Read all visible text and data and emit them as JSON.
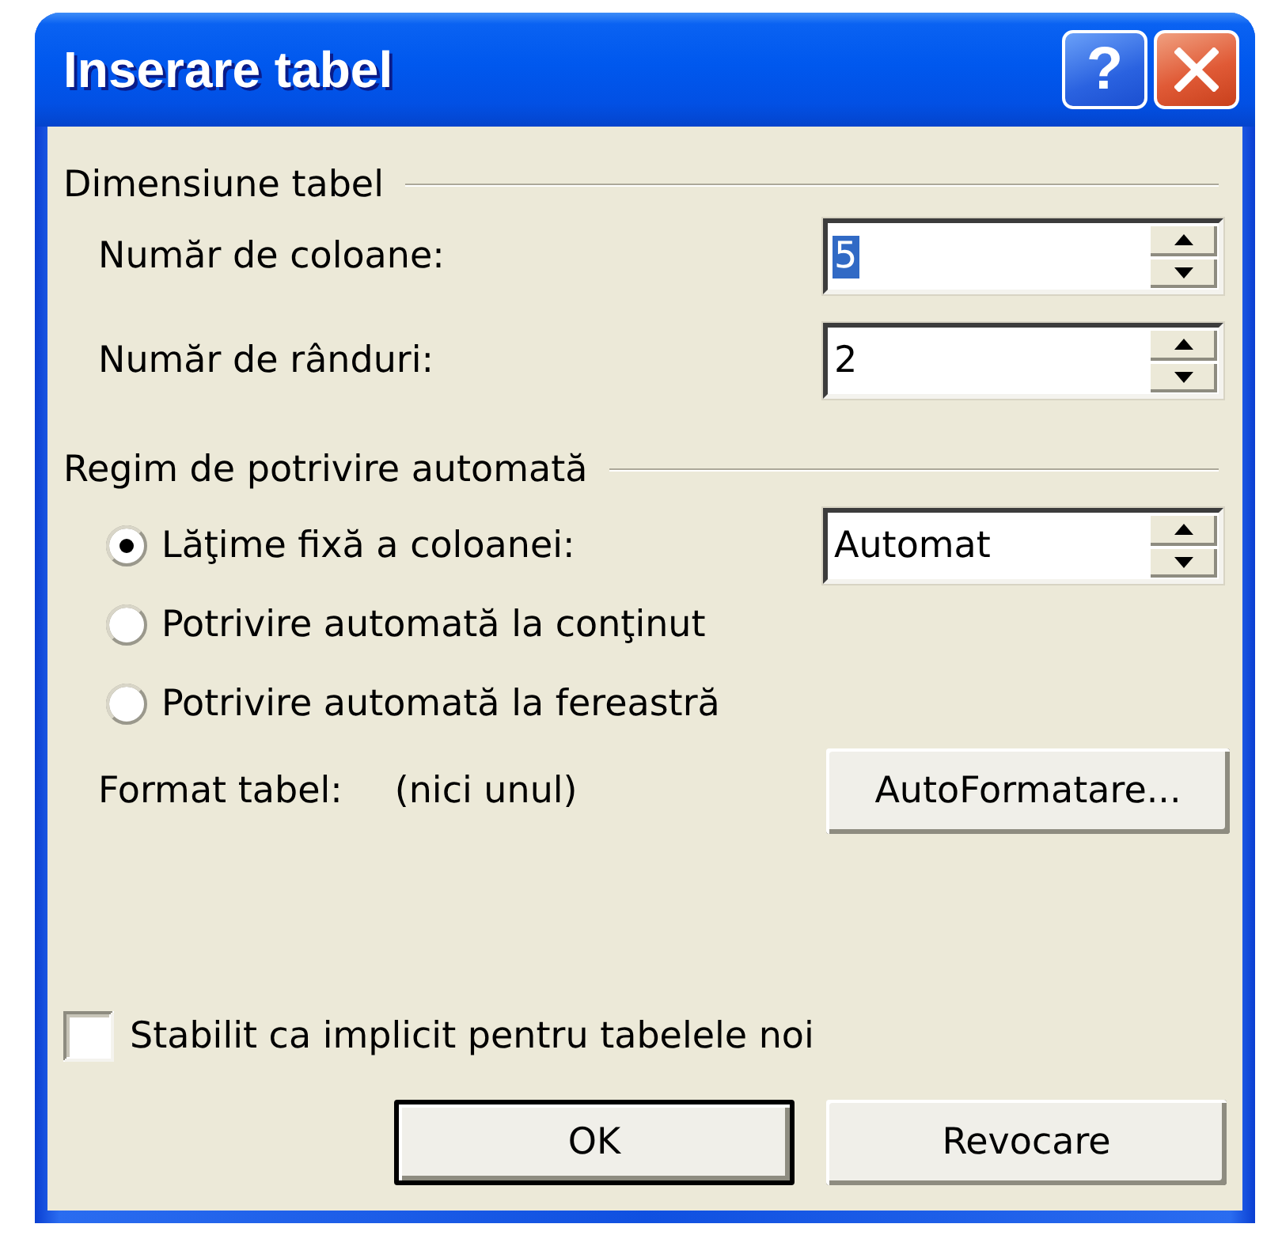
{
  "window": {
    "title": "Inserare tabel",
    "help_label": "?"
  },
  "groups": [
    {
      "title": "Dimensiune tabel",
      "rows": [
        {
          "kind": "spin",
          "label": "Număr de coloane:",
          "value": "5",
          "text_selected": true
        },
        {
          "kind": "spin",
          "label": "Număr de rânduri:",
          "value": "2",
          "text_selected": false
        }
      ]
    },
    {
      "title": "Regim de potrivire automată",
      "rows": [
        {
          "kind": "radio",
          "label": "Lăţime fixă a coloanei:",
          "selected": true,
          "field_value": "Automat"
        },
        {
          "kind": "radio",
          "label": "Potrivire automată la conţinut",
          "selected": false
        },
        {
          "kind": "radio",
          "label": "Potrivire automată la fereastră",
          "selected": false
        },
        {
          "kind": "format",
          "label": "Format tabel:",
          "value": "(nici unul)",
          "button": "AutoFormatare..."
        }
      ]
    }
  ],
  "default_checkbox": {
    "label": "Stabilit ca implicit pentru tabelele noi",
    "checked": false
  },
  "buttons": [
    {
      "label": "OK",
      "default": true
    },
    {
      "label": "Revocare",
      "default": false
    }
  ]
}
